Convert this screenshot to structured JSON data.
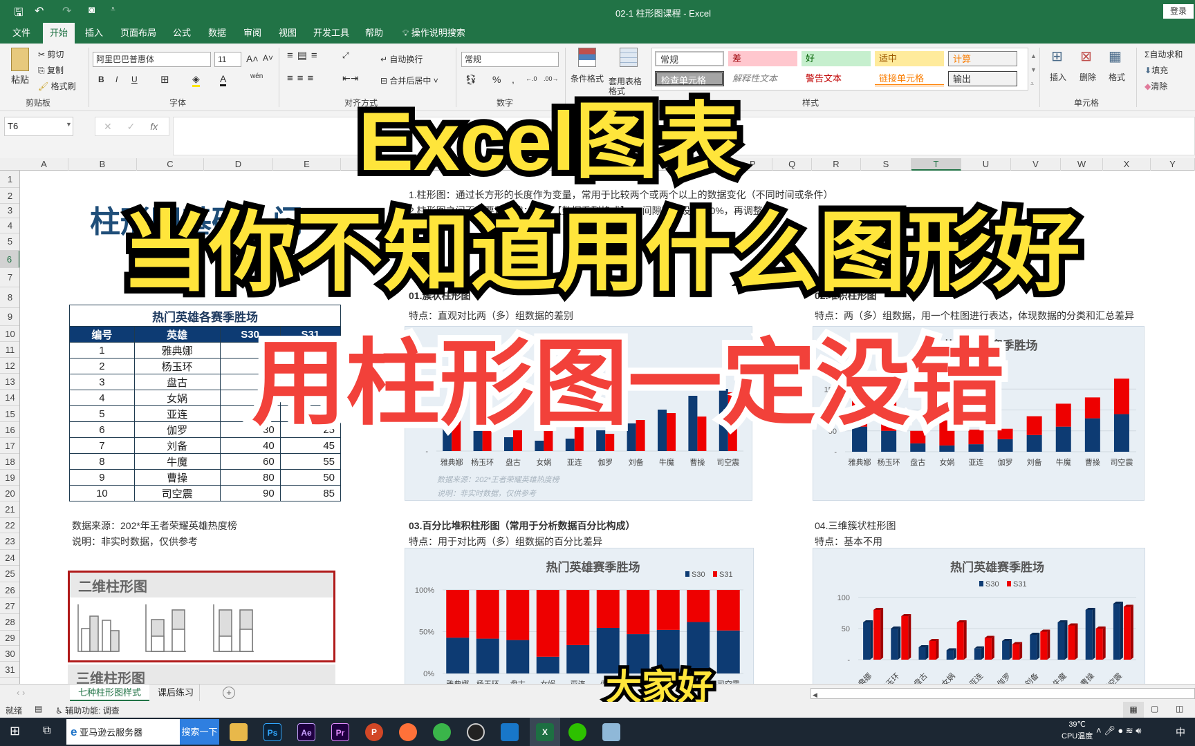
{
  "titlebar": {
    "doc_title": "02-1 柱形图课程  -  Excel",
    "login": "登录",
    "qat": {
      "save": "save-icon",
      "undo": "undo-icon",
      "redo": "redo-icon",
      "camera": "camera-icon"
    }
  },
  "tabs": [
    {
      "label": "文件"
    },
    {
      "label": "开始",
      "active": true
    },
    {
      "label": "插入"
    },
    {
      "label": "页面布局"
    },
    {
      "label": "公式"
    },
    {
      "label": "数据"
    },
    {
      "label": "审阅"
    },
    {
      "label": "视图"
    },
    {
      "label": "开发工具"
    },
    {
      "label": "帮助"
    }
  ],
  "tell_me": "操作说明搜索",
  "ribbon": {
    "clipboard": {
      "paste": "粘贴",
      "cut": "剪切",
      "copy": "复制",
      "painter": "格式刷",
      "label": "剪贴板"
    },
    "font": {
      "name": "阿里巴巴普惠体",
      "size": "11",
      "grow": "A˄",
      "shrink": "A˅",
      "bold": "B",
      "italic": "I",
      "underline": "U",
      "phonetic": "wén",
      "label": "字体"
    },
    "alignment": {
      "wrap": "自动换行",
      "merge": "合并后居中",
      "label": "对齐方式"
    },
    "number": {
      "format": "常规",
      "percent": "%",
      "comma": ",",
      "inc": "←.0",
      "dec": ".00→",
      "label": "数字"
    },
    "styles": {
      "conditional": "条件格式",
      "table": "套用表格格式",
      "cells": [
        "常规",
        "差",
        "好",
        "适中",
        "计算",
        "检查单元格",
        "解释性文本",
        "警告文本",
        "链接单元格",
        "输出"
      ],
      "label": "样式"
    },
    "cells": {
      "insert": "插入",
      "delete": "删除",
      "format": "格式",
      "label": "单元格"
    },
    "editing": {
      "autosum": "自动求和",
      "fill": "填充",
      "clear": "清除"
    }
  },
  "formula": {
    "name_box": "T6",
    "cancel": "✕",
    "enter": "✓",
    "fx": "fx",
    "value": ""
  },
  "columns": [
    "A",
    "B",
    "C",
    "D",
    "E",
    "F",
    "G",
    "H",
    "I",
    "J",
    "K",
    "L",
    "M",
    "N",
    "O",
    "P",
    "Q",
    "R",
    "S",
    "T",
    "U",
    "V",
    "W",
    "X",
    "Y"
  ],
  "selected_column": "T",
  "selected_row": "6",
  "rows": [
    "1",
    "2",
    "3",
    "4",
    "5",
    "6",
    "7",
    "8",
    "9",
    "10",
    "11",
    "12",
    "13",
    "14",
    "15",
    "16",
    "17",
    "18",
    "19",
    "20",
    "21",
    "22",
    "23",
    "24",
    "25",
    "26",
    "27",
    "28",
    "29",
    "30",
    "31"
  ],
  "sheet": {
    "big_title": "柱形图基础入门",
    "note1": "1.柱形图：通过长方形的长度作为变量，常用于比较两个或两个以上的数据变化（不同时间或条件）",
    "note2": "2.柱形图之间不需要留空隙：设置【数据系列格式】→ 间隙宽度设置为0%，再调整",
    "sec1_title": "01.簇状柱形图",
    "sec1_desc": "特点：直观对比两（多）组数据的差别",
    "sec2_title": "02.堆积柱形图",
    "sec2_desc": "特点：两（多）组数据，用一个柱图进行表达，体现数据的分类和汇总差异",
    "sec3_title": "03.百分比堆积柱形图（常用于分析数据百分比构成）",
    "sec3_desc": "特点：用于对比两（多）组数据的百分比差异",
    "sec4_title": "04.三维簇状柱形图",
    "sec4_desc": "特点：基本不用",
    "source": "数据来源：202*年王者荣耀英雄热度榜",
    "remark": "说明：非实时数据，仅供参考",
    "gallery_2d": "二维柱形图",
    "gallery_3d": "三维柱形图",
    "table": {
      "title": "热门英雄各赛季胜场",
      "headers": [
        "编号",
        "英雄",
        "S30",
        "S31"
      ],
      "rows": [
        [
          "1",
          "雅典娜",
          "60",
          "80"
        ],
        [
          "2",
          "杨玉环",
          "50",
          "70"
        ],
        [
          "3",
          "盘古",
          "20",
          "30"
        ],
        [
          "4",
          "女娲",
          "15",
          "60"
        ],
        [
          "5",
          "亚连",
          "18",
          "35"
        ],
        [
          "6",
          "伽罗",
          "30",
          "25"
        ],
        [
          "7",
          "刘备",
          "40",
          "45"
        ],
        [
          "8",
          "牛魔",
          "60",
          "55"
        ],
        [
          "9",
          "曹操",
          "80",
          "50"
        ],
        [
          "10",
          "司空震",
          "90",
          "85"
        ]
      ]
    }
  },
  "chart_data": [
    {
      "type": "bar",
      "title": "热门英雄赛季胜场",
      "categories": [
        "雅典娜",
        "杨玉环",
        "盘古",
        "女娲",
        "亚连",
        "伽罗",
        "刘备",
        "牛魔",
        "曹操",
        "司空震"
      ],
      "series": [
        {
          "name": "S30",
          "values": [
            60,
            50,
            20,
            15,
            18,
            30,
            40,
            60,
            80,
            90
          ]
        },
        {
          "name": "S31",
          "values": [
            80,
            70,
            30,
            60,
            35,
            25,
            45,
            55,
            50,
            85
          ]
        }
      ],
      "ylim": [
        0,
        100
      ],
      "yticks": [
        "-"
      ],
      "notes": [
        "数据来源：202*王者荣耀英雄热度榜",
        "说明：非实时数据，仅供参考"
      ],
      "colors": [
        "#0d3b73",
        "#ee0000"
      ]
    },
    {
      "type": "stacked-bar",
      "title": "热门英雄赛季胜场",
      "categories": [
        "雅典娜",
        "杨玉环",
        "盘古",
        "女娲",
        "亚连",
        "伽罗",
        "刘备",
        "牛魔",
        "曹操",
        "司空震"
      ],
      "series": [
        {
          "name": "S30",
          "values": [
            60,
            50,
            20,
            15,
            18,
            30,
            40,
            60,
            80,
            90
          ]
        },
        {
          "name": "S31",
          "values": [
            80,
            70,
            30,
            60,
            35,
            25,
            45,
            55,
            50,
            85
          ]
        }
      ],
      "ylim": [
        0,
        200
      ],
      "yticks": [
        "-",
        "50",
        "100",
        "150"
      ],
      "grid": true,
      "colors": [
        "#0d3b73",
        "#ee0000"
      ]
    },
    {
      "type": "percent-stacked-bar",
      "title": "热门英雄赛季胜场",
      "categories": [
        "雅典娜",
        "杨玉环",
        "盘古",
        "女娲",
        "亚连",
        "伽罗",
        "刘备",
        "牛魔",
        "曹操",
        "司空震"
      ],
      "series": [
        {
          "name": "S30",
          "values": [
            60,
            50,
            20,
            15,
            18,
            30,
            40,
            60,
            80,
            90
          ]
        },
        {
          "name": "S31",
          "values": [
            80,
            70,
            30,
            60,
            35,
            25,
            45,
            55,
            50,
            85
          ]
        }
      ],
      "ylim": [
        0,
        1
      ],
      "yticks": [
        "0%",
        "50%",
        "100%"
      ],
      "legend": "top-right",
      "grid": true,
      "colors": [
        "#0d3b73",
        "#ee0000"
      ]
    },
    {
      "type": "bar-3d",
      "title": "热门英雄赛季胜场",
      "categories": [
        "雅典娜",
        "杨玉环",
        "盘古",
        "女娲",
        "亚连",
        "伽罗",
        "刘备",
        "牛魔",
        "曹操",
        "司空震"
      ],
      "series": [
        {
          "name": "S30",
          "values": [
            60,
            50,
            20,
            15,
            18,
            30,
            40,
            60,
            80,
            90
          ]
        },
        {
          "name": "S31",
          "values": [
            80,
            70,
            30,
            60,
            35,
            25,
            45,
            55,
            50,
            85
          ]
        }
      ],
      "ylim": [
        0,
        100
      ],
      "yticks": [
        "-",
        "50",
        "100"
      ],
      "legend": "top",
      "grid": true,
      "colors": [
        "#0d3b73",
        "#ee0000"
      ]
    }
  ],
  "overlay": {
    "line1": "Excel图表",
    "line2": "当你不知道用什么图形好",
    "line3": "用柱形图一定没错",
    "subtitle": "大家好"
  },
  "sheet_tabs": [
    {
      "label": "七种柱形图样式",
      "active": true
    },
    {
      "label": "课后练习"
    }
  ],
  "add_sheet": "+",
  "status": {
    "ready": "就绪",
    "accessibility": "辅助功能: 调查"
  },
  "taskbar": {
    "search_text": "亚马逊云服务器",
    "search_button": "搜索一下",
    "apps": [
      "file-explorer",
      "photoshop",
      "after-effects",
      "premiere",
      "powerpoint",
      "firefox",
      "browser",
      "media-player",
      "app",
      "excel",
      "wechat",
      "notepad"
    ],
    "app_labels": {
      "ps": "Ps",
      "ae": "Ae",
      "pr": "Pr",
      "ppt": "P",
      "excel": "X"
    },
    "temp": "39℃",
    "temp_label": "CPU温度",
    "ime": "中"
  }
}
